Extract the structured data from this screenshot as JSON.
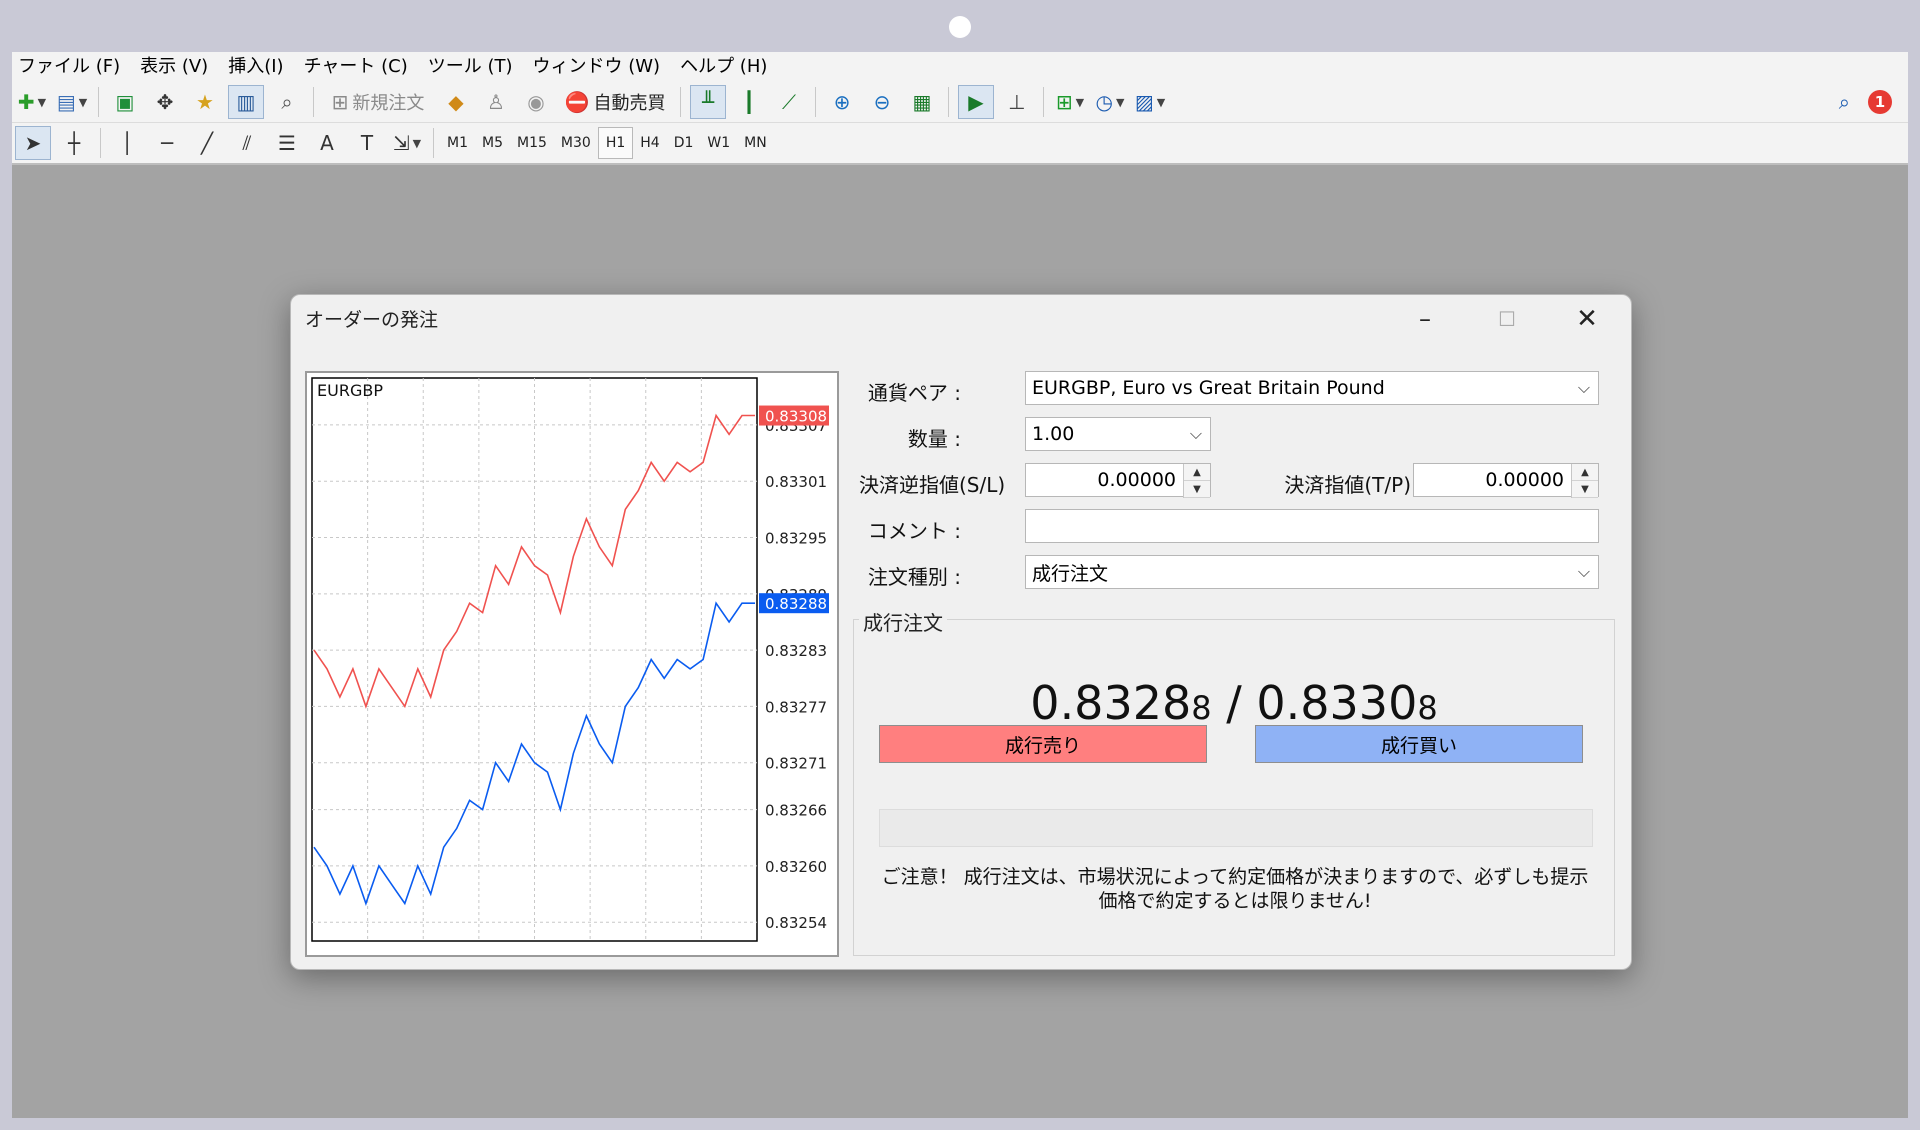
{
  "menu": [
    "ファイル (F)",
    "表示 (V)",
    "挿入(I)",
    "チャート (C)",
    "ツール (T)",
    "ウィンドウ (W)",
    "ヘルプ (H)"
  ],
  "toolbar": {
    "new_order_label": "新規注文",
    "auto_trade_label": "自動売買",
    "notification_count": "1"
  },
  "timeframes": [
    "M1",
    "M5",
    "M15",
    "M30",
    "H1",
    "H4",
    "D1",
    "W1",
    "MN"
  ],
  "selected_timeframe": "H1",
  "dialog": {
    "title": "オーダーの発注",
    "symbol_label": "通貨ペア :",
    "symbol_value": "EURGBP, Euro vs Great Britain Pound",
    "volume_label": "数量 :",
    "volume_value": "1.00",
    "sl_label": "決済逆指値(S/L)",
    "sl_value": "0.00000",
    "tp_label": "決済指値(T/P)",
    "tp_value": "0.00000",
    "comment_label": "コメント :",
    "comment_value": "",
    "type_label": "注文種別 :",
    "type_value": "成行注文",
    "group_title": "成行注文",
    "bid_main": "0.8328",
    "bid_small": "8",
    "separator": " / ",
    "ask_main": "0.8330",
    "ask_small": "8",
    "sell_button": "成行売り",
    "buy_button": "成行買い",
    "notice_line1": "ご注意！ 成行注文は、市場状況によって約定価格が決まりますので、必ずしも提示",
    "notice_line2": "価格で約定するとは限りません!"
  },
  "chart_data": {
    "type": "line",
    "title": "EURGBP",
    "ylim": [
      0.83252,
      0.83312
    ],
    "y_ticks": [
      "0.83307",
      "0.83301",
      "0.83295",
      "0.83289",
      "0.83283",
      "0.83277",
      "0.83271",
      "0.83266",
      "0.83260",
      "0.83254"
    ],
    "y_tick_values": [
      0.83307,
      0.83301,
      0.83295,
      0.83289,
      0.83283,
      0.83277,
      0.83271,
      0.83266,
      0.8326,
      0.83254
    ],
    "ask_label": "0.83308",
    "bid_label": "0.83288",
    "grid": true,
    "colors": {
      "ask": "#f0524f",
      "bid": "#0a5cf0"
    },
    "series": [
      {
        "values": [
          0.83283,
          0.83281,
          0.83278,
          0.83281,
          0.83277,
          0.83281,
          0.83279,
          0.83277,
          0.83281,
          0.83278,
          0.83283,
          0.83285,
          0.83288,
          0.83287,
          0.83292,
          0.8329,
          0.83294,
          0.83292,
          0.83291,
          0.83287,
          0.83293,
          0.83297,
          0.83294,
          0.83292,
          0.83298,
          0.833,
          0.83303,
          0.83301,
          0.83303,
          0.83302,
          0.83303,
          0.83308,
          0.83306,
          0.83308,
          0.83308
        ]
      },
      {
        "values": [
          0.83262,
          0.8326,
          0.83257,
          0.8326,
          0.83256,
          0.8326,
          0.83258,
          0.83256,
          0.8326,
          0.83257,
          0.83262,
          0.83264,
          0.83267,
          0.83266,
          0.83271,
          0.83269,
          0.83273,
          0.83271,
          0.8327,
          0.83266,
          0.83272,
          0.83276,
          0.83273,
          0.83271,
          0.83277,
          0.83279,
          0.83282,
          0.8328,
          0.83282,
          0.83281,
          0.83282,
          0.83288,
          0.83286,
          0.83288,
          0.83288
        ]
      }
    ]
  }
}
